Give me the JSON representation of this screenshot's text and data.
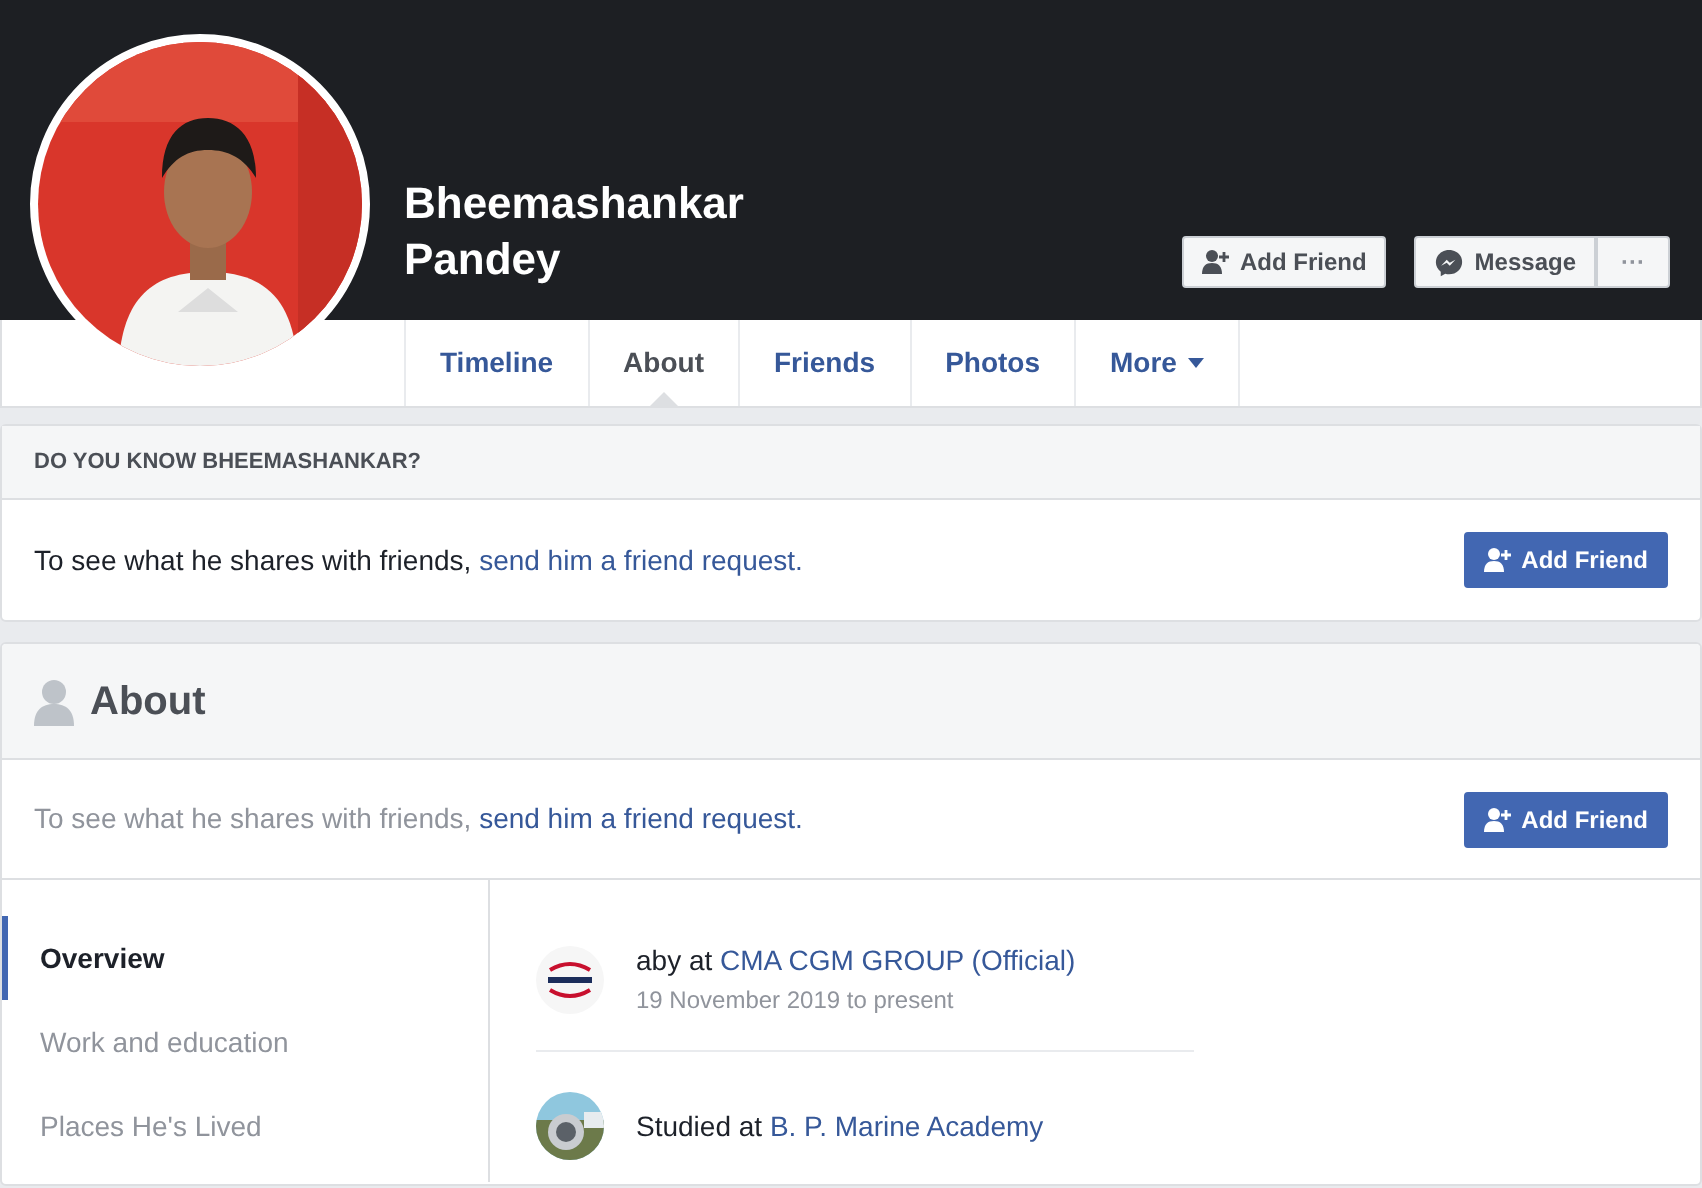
{
  "profile": {
    "name": "Bheemashankar Pandey"
  },
  "header_buttons": [
    {
      "kind": "add-friend",
      "label": "Add Friend"
    },
    {
      "kind": "message",
      "label": "Message"
    },
    {
      "kind": "more",
      "label": "···"
    }
  ],
  "tabs": [
    {
      "label": "Timeline",
      "selected": false,
      "dropdown": false
    },
    {
      "label": "About",
      "selected": true,
      "dropdown": false
    },
    {
      "label": "Friends",
      "selected": false,
      "dropdown": false
    },
    {
      "label": "Photos",
      "selected": false,
      "dropdown": false
    },
    {
      "label": "More",
      "selected": false,
      "dropdown": true
    }
  ],
  "know_card": {
    "title": "DO YOU KNOW BHEEMASHANKAR?",
    "text": "To see what he shares with friends,",
    "link": "send him a friend request.",
    "button": "Add Friend"
  },
  "about": {
    "title": "About",
    "text": "To see what he shares with friends,",
    "link": "send him a friend request.",
    "button": "Add Friend",
    "sections": [
      {
        "label": "Overview",
        "selected": true
      },
      {
        "label": "Work and education",
        "selected": false
      },
      {
        "label": "Places He's Lived",
        "selected": false
      }
    ],
    "entries": [
      {
        "kind": "logo",
        "prefix": "aby at",
        "link": "CMA CGM GROUP (Official)",
        "sub": "19 November 2019 to present"
      },
      {
        "prefix": "Studied at",
        "link": "B. P. Marine Academy"
      }
    ]
  }
}
